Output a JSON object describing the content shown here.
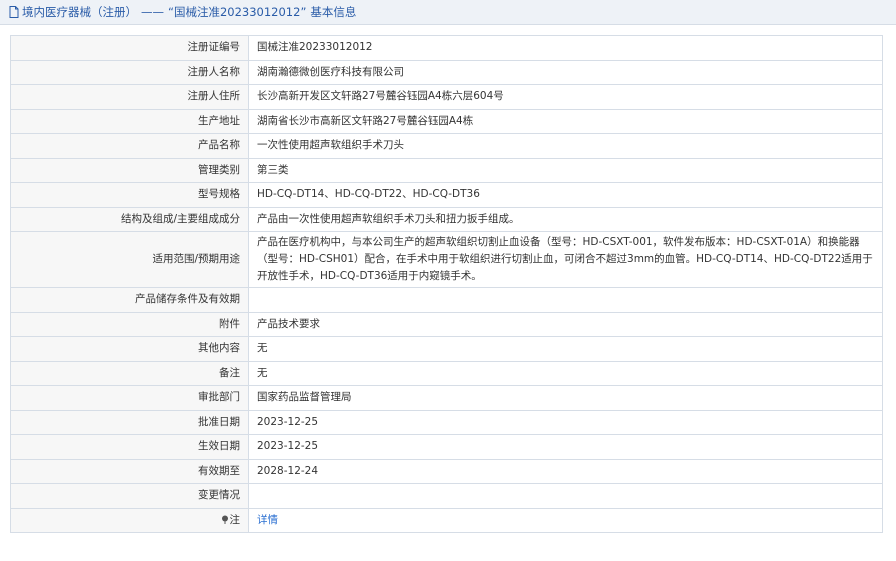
{
  "header": {
    "category": "境内医疗器械（注册）",
    "separator": "——",
    "subject": "“国械注准20233012012”",
    "suffix": "基本信息"
  },
  "rows": [
    {
      "label": "注册证编号",
      "value": "国械注准20233012012"
    },
    {
      "label": "注册人名称",
      "value": "湖南瀚德微创医疗科技有限公司"
    },
    {
      "label": "注册人住所",
      "value": "长沙高新开发区文轩路27号麓谷钰园A4栋六层604号"
    },
    {
      "label": "生产地址",
      "value": "湖南省长沙市高新区文轩路27号麓谷钰园A4栋"
    },
    {
      "label": "产品名称",
      "value": "一次性使用超声软组织手术刀头"
    },
    {
      "label": "管理类别",
      "value": "第三类"
    },
    {
      "label": "型号规格",
      "value": "HD-CQ-DT14、HD-CQ-DT22、HD-CQ-DT36"
    },
    {
      "label": "结构及组成/主要组成成分",
      "value": "产品由一次性使用超声软组织手术刀头和扭力扳手组成。"
    },
    {
      "label": "适用范围/预期用途",
      "value": "产品在医疗机构中，与本公司生产的超声软组织切割止血设备（型号：HD-CSXT-001，软件发布版本：HD-CSXT-01A）和换能器（型号：HD-CSH01）配合，在手术中用于软组织进行切割止血，可闭合不超过3mm的血管。HD-CQ-DT14、HD-CQ-DT22适用于开放性手术，HD-CQ-DT36适用于内窥镜手术。"
    },
    {
      "label": "产品储存条件及有效期",
      "value": ""
    },
    {
      "label": "附件",
      "value": "产品技术要求"
    },
    {
      "label": "其他内容",
      "value": "无"
    },
    {
      "label": "备注",
      "value": "无"
    },
    {
      "label": "审批部门",
      "value": "国家药品监督管理局"
    },
    {
      "label": "批准日期",
      "value": "2023-12-25"
    },
    {
      "label": "生效日期",
      "value": "2023-12-25"
    },
    {
      "label": "有效期至",
      "value": "2028-12-24"
    },
    {
      "label": "变更情况",
      "value": ""
    }
  ],
  "note_row": {
    "label": "注",
    "link": "详情"
  },
  "colors": {
    "link": "#2a6fd1",
    "header_text": "#2a5ca8",
    "border": "#d6dde6"
  }
}
